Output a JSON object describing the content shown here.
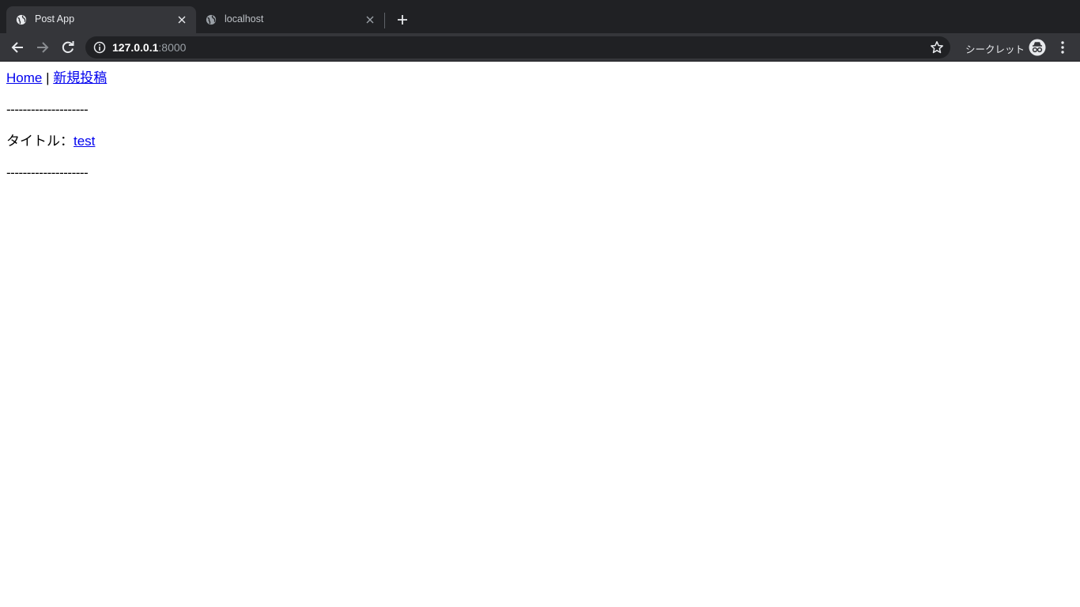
{
  "browser": {
    "tabs": [
      {
        "title": "Post App",
        "active": true
      },
      {
        "title": "localhost",
        "active": false
      }
    ],
    "address": {
      "host": "127.0.0.1",
      "port": ":8000"
    },
    "incognito_label": "シークレット"
  },
  "page": {
    "nav": {
      "home_link": "Home",
      "separator": " | ",
      "new_post_link": "新規投稿"
    },
    "divider": "--------------------",
    "post": {
      "title_label": "タイトル：",
      "title_link": "test"
    },
    "divider_end": "--------------------"
  },
  "colors": {
    "tabstrip_bg": "#202124",
    "toolbar_bg": "#35363a",
    "link": "#0000ee"
  },
  "icons": {
    "favicon": "globe-icon",
    "close": "close-icon",
    "new_tab": "plus-icon",
    "back": "back-arrow-icon",
    "forward": "forward-arrow-icon",
    "reload": "reload-icon",
    "info": "info-icon",
    "bookmark": "star-icon",
    "incognito": "incognito-icon",
    "menu": "kebab-menu-icon"
  }
}
